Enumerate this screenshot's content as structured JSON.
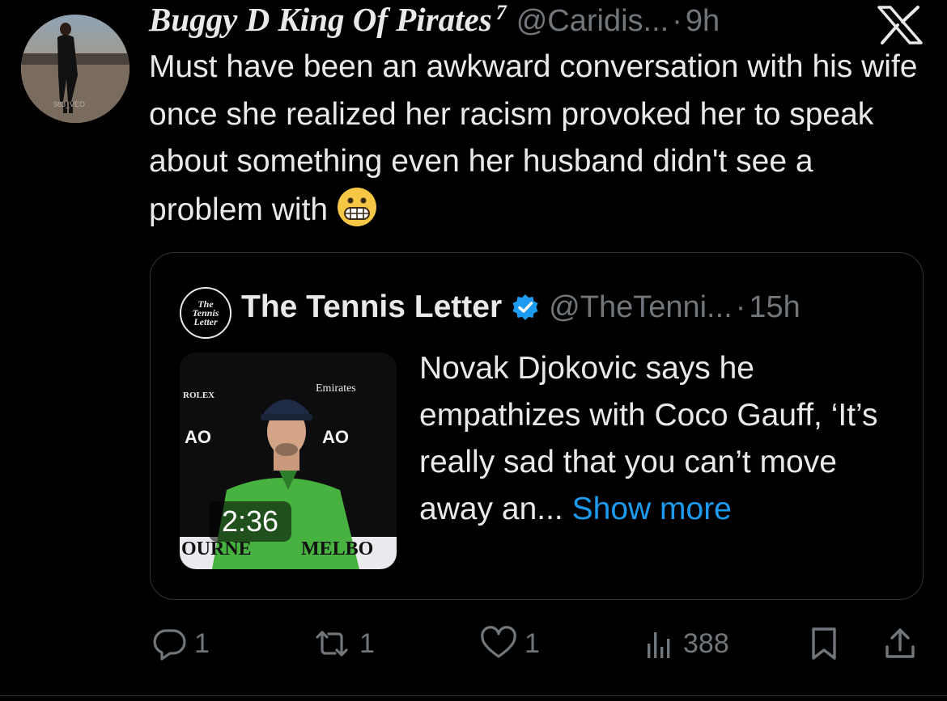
{
  "tweet": {
    "author_name": "Buggy D King Of Pirates",
    "author_superscript": "7",
    "handle": "@Caridis...",
    "separator": "·",
    "time": "9h",
    "text": "Must have been an awkward conversation with his wife once she realized her racism provoked her to speak about something even her husband didn't see a problem with",
    "emoji": "grimacing-face-emoji",
    "avatar_caption": "983_VEO"
  },
  "quote": {
    "avatar_text": [
      "The",
      "Tennis",
      "Letter"
    ],
    "author_name": "The Tennis Letter",
    "verified_color": "#1d9bf0",
    "handle": "@TheTenni...",
    "separator": "·",
    "time": "15h",
    "text": "Novak Djokovic says he empathizes with Coco Gauff, ‘It’s really sad that you can’t move away an...",
    "show_more": "Show more",
    "video_duration": "2:36",
    "video_overlay_texts": {
      "rolex": "ROLEX",
      "emirates": "Emirates",
      "ao_left": "AO",
      "ao_right": "AO",
      "melbourne": "OURNE",
      "melbourne2": "MELBO"
    }
  },
  "actions": {
    "replies": "1",
    "reposts": "1",
    "likes": "1",
    "views": "388"
  },
  "colors": {
    "background": "#000000",
    "text": "#e7e9ea",
    "muted": "#71767b",
    "link": "#1d9bf0",
    "border": "#2f3336"
  }
}
